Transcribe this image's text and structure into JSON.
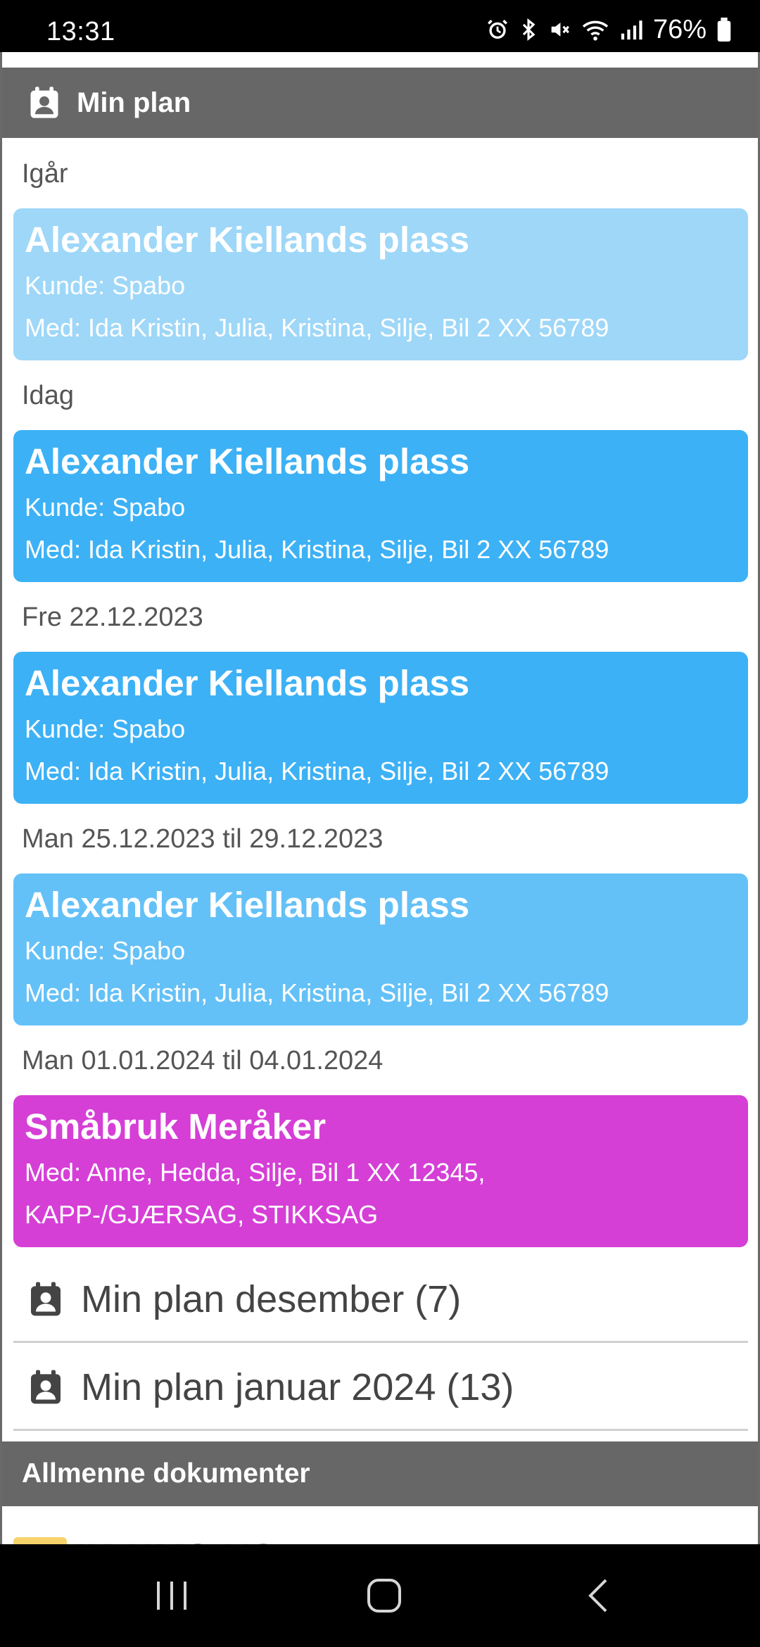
{
  "status": {
    "time": "13:31",
    "battery": "76%"
  },
  "header": {
    "title": "Min plan",
    "icon": "calendar-person-icon"
  },
  "entries": [
    {
      "date": "Igår",
      "card": {
        "title": "Alexander Kiellands plass",
        "line1": "Kunde: Spabo",
        "line2": "Med: Ida Kristin, Julia, Kristina, Silje, Bil 2 XX 56789",
        "color": "#9ed7f8"
      }
    },
    {
      "date": "Idag",
      "card": {
        "title": "Alexander Kiellands plass",
        "line1": "Kunde: Spabo",
        "line2": "Med: Ida Kristin, Julia, Kristina, Silje, Bil 2 XX 56789",
        "color": "#3db1f5"
      }
    },
    {
      "date": "Fre 22.12.2023",
      "card": {
        "title": "Alexander Kiellands plass",
        "line1": "Kunde: Spabo",
        "line2": "Med: Ida Kristin, Julia, Kristina, Silje, Bil 2 XX 56789",
        "color": "#3db1f5"
      }
    },
    {
      "date": "Man 25.12.2023 til 29.12.2023",
      "card": {
        "title": "Alexander Kiellands plass",
        "line1": "Kunde: Spabo",
        "line2": "Med: Ida Kristin, Julia, Kristina, Silje, Bil 2 XX 56789",
        "color": "#64c1f7"
      }
    },
    {
      "date": "Man 01.01.2024 til 04.01.2024",
      "card": {
        "title": "Småbruk Meråker",
        "line1": "Med: Anne, Hedda, Silje, Bil 1 XX 12345,",
        "line2": "KAPP-/GJÆRSAG, STIKKSAG",
        "color": "#d53fd6"
      }
    }
  ],
  "plan_links": [
    {
      "label": "Min plan desember (7)"
    },
    {
      "label": "Min plan januar 2024 (13)"
    }
  ],
  "documents": {
    "title": "Allmenne dokumenter",
    "first_item": "IK-HMS-KS"
  }
}
